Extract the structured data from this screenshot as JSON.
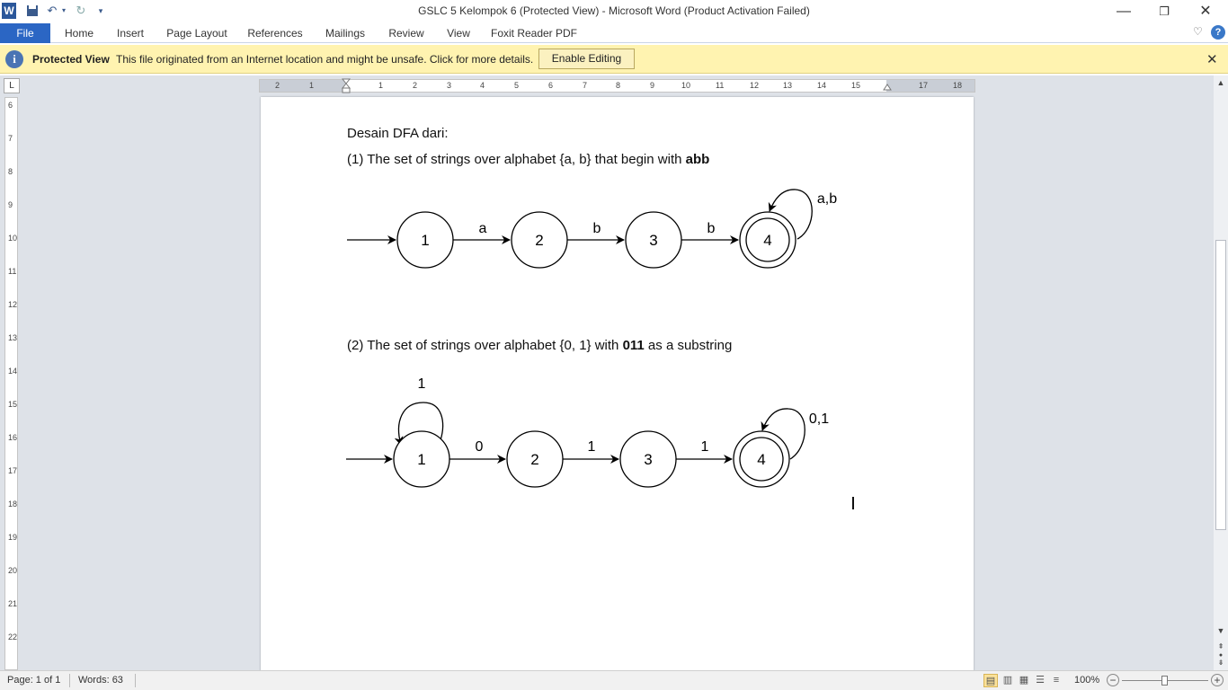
{
  "window": {
    "title": "GSLC 5 Kelompok 6 (Protected View)  -  Microsoft Word (Product Activation Failed)",
    "app_icon": "W",
    "controls": {
      "minimize": "—",
      "restore": "❐",
      "close": "✕"
    }
  },
  "qat": {
    "save_icon": "save-icon",
    "undo_icon": "undo-icon",
    "redo_icon": "redo-icon"
  },
  "ribbon": {
    "tabs": [
      "File",
      "Home",
      "Insert",
      "Page Layout",
      "References",
      "Mailings",
      "Review",
      "View",
      "Foxit Reader PDF"
    ],
    "collapse_glyph": "♡",
    "help_glyph": "?"
  },
  "protected_view": {
    "title": "Protected View",
    "message": "This file originated from an Internet location and might be unsafe. Click for more details.",
    "button": "Enable Editing",
    "close": "✕"
  },
  "ruler": {
    "corner": "L",
    "h_left": [
      "2",
      "1"
    ],
    "h_right": [
      "1",
      "2",
      "3",
      "4",
      "5",
      "6",
      "7",
      "8",
      "9",
      "10",
      "11",
      "12",
      "13",
      "14",
      "15",
      "17",
      "18"
    ],
    "v": [
      "6",
      "7",
      "8",
      "9",
      "10",
      "11",
      "12",
      "13",
      "14",
      "15",
      "16",
      "17",
      "18",
      "19",
      "20",
      "21",
      "22"
    ]
  },
  "document": {
    "heading": "Desain DFA dari:",
    "p1_prefix": "(1) The set of strings over alphabet {a, b} that begin with ",
    "p1_bold": "abb",
    "p2_prefix": "(2) The set of strings over alphabet {0, 1} with ",
    "p2_bold": "011",
    "p2_suffix": " as a substring"
  },
  "diagram1": {
    "states": [
      "1",
      "2",
      "3",
      "4"
    ],
    "transitions": [
      "a",
      "b",
      "b"
    ],
    "final_state": "4",
    "final_loop_label": "a,b"
  },
  "diagram2": {
    "states": [
      "1",
      "2",
      "3",
      "4"
    ],
    "transitions": [
      "0",
      "1",
      "1"
    ],
    "start_loop_label": "1",
    "final_state": "4",
    "final_loop_label": "0,1"
  },
  "status": {
    "page": "Page: 1 of 1",
    "words": "Words: 63",
    "zoom": "100%",
    "zoom_level_percent": 100
  },
  "colors": {
    "accent": "#2b579a",
    "file_tab": "#2b66c4",
    "protected_bar": "#fff3b0",
    "workspace": "#dee2e8"
  }
}
